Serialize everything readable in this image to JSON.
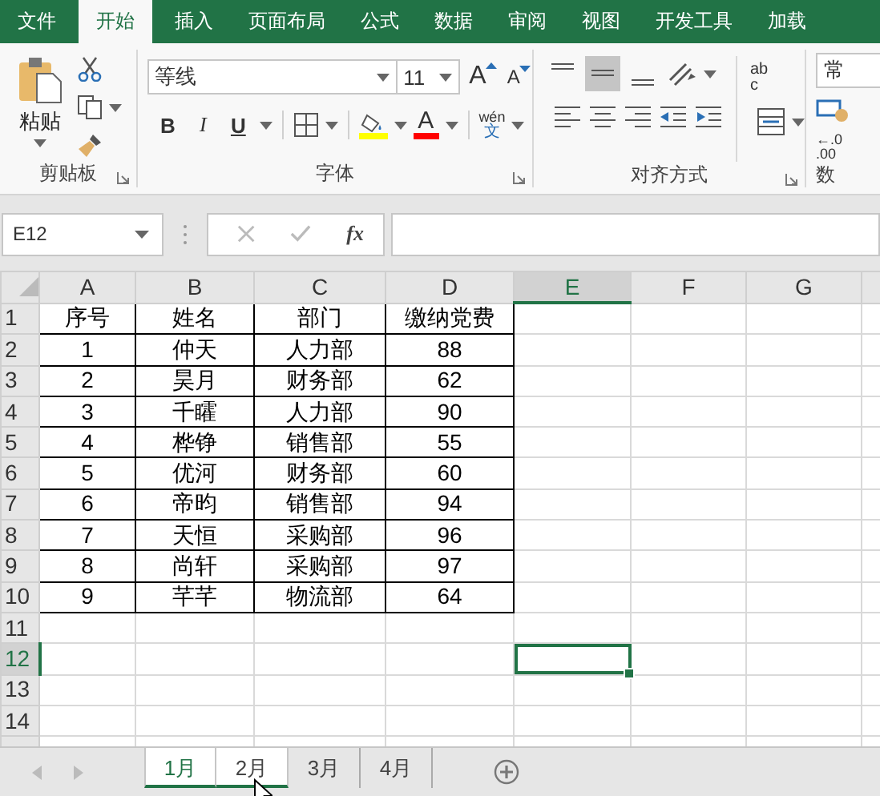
{
  "ribbon_tabs": [
    {
      "label": "文件",
      "selected": false
    },
    {
      "label": "开始",
      "selected": true
    },
    {
      "label": "插入",
      "selected": false
    },
    {
      "label": "页面布局",
      "selected": false
    },
    {
      "label": "公式",
      "selected": false
    },
    {
      "label": "数据",
      "selected": false
    },
    {
      "label": "审阅",
      "selected": false
    },
    {
      "label": "视图",
      "selected": false
    },
    {
      "label": "开发工具",
      "selected": false
    },
    {
      "label": "加载",
      "selected": false
    }
  ],
  "clipboard": {
    "paste_label": "粘贴",
    "group_label": "剪贴板"
  },
  "font": {
    "name": "等线",
    "size": "11",
    "grow_glyph": "A",
    "shrink_glyph": "A",
    "bold": "B",
    "italic": "I",
    "underline": "U",
    "color_glyph": "A",
    "phonetic_top": "wén",
    "phonetic_bottom": "文",
    "group_label": "字体"
  },
  "alignment": {
    "wrap_glyph_top": "ab",
    "wrap_glyph_bottom": "c",
    "group_label": "对齐方式",
    "middle_align_on": true
  },
  "number": {
    "format": "常",
    "decimal_top": "←.0",
    "decimal_bottom": ".00",
    "group_label": "数"
  },
  "formula_bar": {
    "name_box": "E12",
    "fx": "fx"
  },
  "columns": [
    {
      "label": "A",
      "selected": false
    },
    {
      "label": "B",
      "selected": false
    },
    {
      "label": "C",
      "selected": false
    },
    {
      "label": "D",
      "selected": false
    },
    {
      "label": "E",
      "selected": true
    },
    {
      "label": "F",
      "selected": false
    },
    {
      "label": "G",
      "selected": false
    }
  ],
  "rows": [
    {
      "header": "1",
      "selected": false,
      "cells": [
        "序号",
        "姓名",
        "部门",
        "缴纳党费"
      ]
    },
    {
      "header": "2",
      "selected": false,
      "cells": [
        "1",
        "仲天",
        "人力部",
        "88"
      ]
    },
    {
      "header": "3",
      "selected": false,
      "cells": [
        "2",
        "昊月",
        "财务部",
        "62"
      ]
    },
    {
      "header": "4",
      "selected": false,
      "cells": [
        "3",
        "千矐",
        "人力部",
        "90"
      ]
    },
    {
      "header": "5",
      "selected": false,
      "cells": [
        "4",
        "桦铮",
        "销售部",
        "55"
      ]
    },
    {
      "header": "6",
      "selected": false,
      "cells": [
        "5",
        "优河",
        "财务部",
        "60"
      ]
    },
    {
      "header": "7",
      "selected": false,
      "cells": [
        "6",
        "帝昀",
        "销售部",
        "94"
      ]
    },
    {
      "header": "8",
      "selected": false,
      "cells": [
        "7",
        "天恒",
        "采购部",
        "96"
      ]
    },
    {
      "header": "9",
      "selected": false,
      "cells": [
        "8",
        "尚轩",
        "采购部",
        "97"
      ]
    },
    {
      "header": "10",
      "selected": false,
      "cells": [
        "9",
        "芊芊",
        "物流部",
        "64"
      ]
    },
    {
      "header": "11",
      "selected": false
    },
    {
      "header": "12",
      "selected": true
    },
    {
      "header": "13",
      "selected": false
    },
    {
      "header": "14",
      "selected": false
    }
  ],
  "sheet_tabs": [
    {
      "label": "1月",
      "selected": true,
      "active": true
    },
    {
      "label": "2月",
      "selected": true,
      "active": false
    },
    {
      "label": "3月",
      "selected": false,
      "active": false
    },
    {
      "label": "4月",
      "selected": false,
      "active": false
    }
  ]
}
